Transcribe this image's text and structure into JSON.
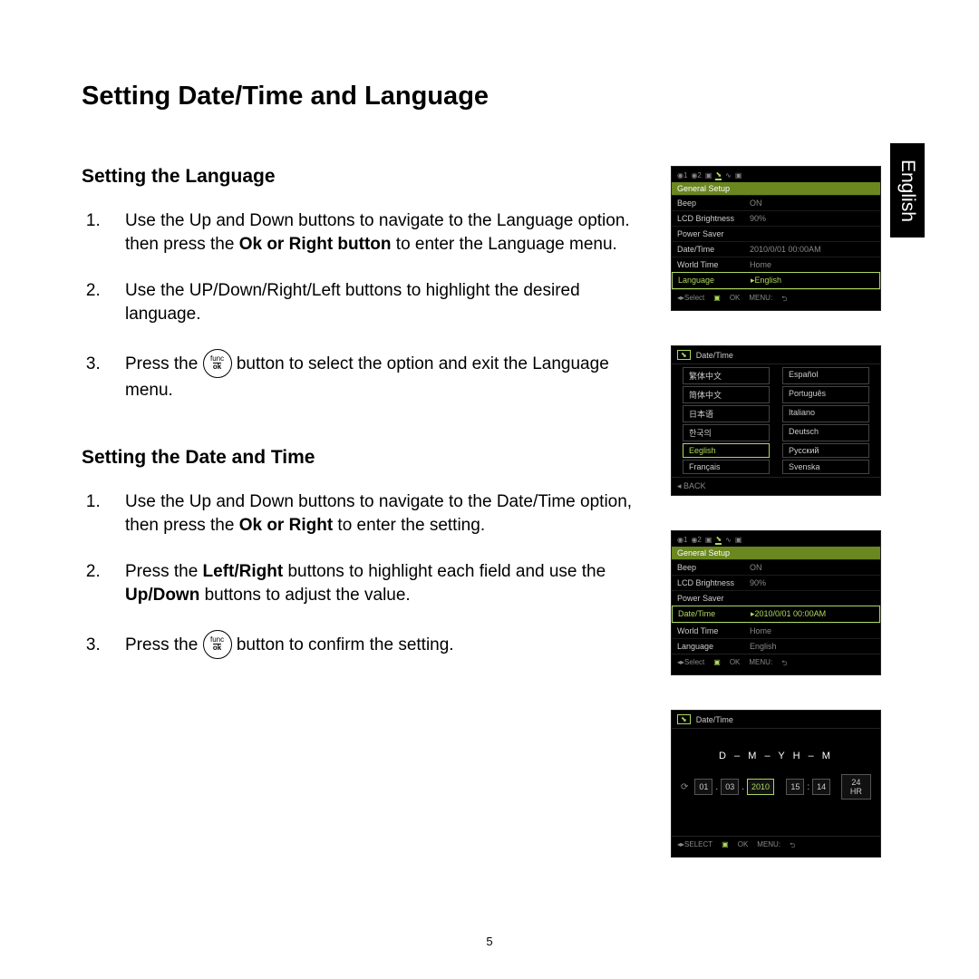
{
  "page_number": "5",
  "language_tab": "English",
  "main_title": "Setting Date/Time and Language",
  "section1": {
    "heading": "Setting the Language",
    "step1_a": "Use the Up and Down buttons to navigate to the Language option. then press the ",
    "step1_bold": "Ok or Right button",
    "step1_b": " to enter the Language menu.",
    "step2": "Use the UP/Down/Right/Left buttons to highlight the desired language.",
    "step3_a": "Press the ",
    "step3_b": " button to select the option and exit the Language menu."
  },
  "section2": {
    "heading": "Setting the Date and Time",
    "step1_a": "Use the Up and Down buttons to navigate to the Date/Time option, then press the ",
    "step1_bold": "Ok or Right",
    "step1_b": " to enter the setting.",
    "step2_a": "Press the ",
    "step2_bold1": "Left/Right",
    "step2_b": " buttons to highlight each field and use the ",
    "step2_bold2": "Up/Down",
    "step2_c": " buttons to adjust the value.",
    "step3_a": "Press the ",
    "step3_b": " button to confirm the setting."
  },
  "func_button": {
    "top": "func",
    "bottom": "ok"
  },
  "screen_generic": {
    "title": "General Setup",
    "rows": {
      "beep": {
        "label": "Beep",
        "value": "ON"
      },
      "lcd": {
        "label": "LCD Brightness",
        "value": "90%"
      },
      "ps": {
        "label": "Power Saver",
        "value": ""
      },
      "dt": {
        "label": "Date/Time",
        "value": "2010/0/01 00:00AM"
      },
      "wt": {
        "label": "World Time",
        "value": "Home"
      },
      "lang": {
        "label": "Language",
        "value": "▸English"
      },
      "lang_plain": {
        "label": "Language",
        "value": "English"
      },
      "dt_sel": {
        "label": "Date/Time",
        "value": "▸2010/0/01 00:00AM"
      }
    },
    "foot": {
      "select": "Select",
      "ok": "OK",
      "menu": "MENU:"
    }
  },
  "screen_lang": {
    "title": "Date/Time",
    "cells": {
      "c0": "繁体中文",
      "c1": "Español",
      "c2": "简体中文",
      "c3": "Português",
      "c4": "日本语",
      "c5": "Italiano",
      "c6": "한국의",
      "c7": "Deutsch",
      "c8": "Eeglish",
      "c9": "Русский",
      "c10": "Français",
      "c11": "Svenska"
    },
    "back": "◂ BACK"
  },
  "screen_dt": {
    "title": "Date/Time",
    "labels": "D – M – Y      H – M",
    "f": {
      "d": "01",
      "dot1": ".",
      "m": "03",
      "dot2": ".",
      "y": "2010",
      "h": "15",
      "col": ":",
      "min": "14",
      "fmt": "24 HR"
    },
    "foot": {
      "select": "SELECT",
      "ok": "OK",
      "menu": "MENU:"
    }
  }
}
